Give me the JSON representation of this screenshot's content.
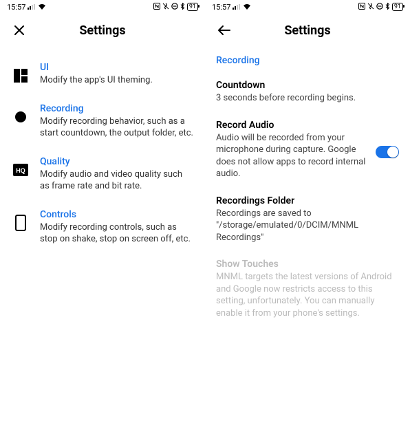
{
  "status_bar": {
    "time": "15:57",
    "battery": "91"
  },
  "left_screen": {
    "header_title": "Settings",
    "items": [
      {
        "title": "UI",
        "desc": "Modify the app's UI theming."
      },
      {
        "title": "Recording",
        "desc": "Modify recording behavior, such as a start countdown, the output folder, etc."
      },
      {
        "title": "Quality",
        "desc": "Modify audio and video quality such as frame rate and bit rate."
      },
      {
        "title": "Controls",
        "desc": "Modify recording controls, such as stop on shake, stop on screen off, etc."
      }
    ]
  },
  "right_screen": {
    "header_title": "Settings",
    "section_header": "Recording",
    "countdown": {
      "title": "Countdown",
      "desc": "3 seconds before recording begins."
    },
    "record_audio": {
      "title": "Record Audio",
      "desc": "Audio will be recorded from your microphone during capture. Google does not allow apps to record internal audio."
    },
    "recordings_folder": {
      "title": "Recordings Folder",
      "desc": "Recordings are saved to \"/storage/emulated/0/DCIM/MNML Recordings\""
    },
    "show_touches": {
      "title": "Show Touches",
      "desc": "MNML targets the latest versions of Android and Google now restricts access to this setting, unfortunately. You can manually enable it from your phone's settings."
    }
  }
}
